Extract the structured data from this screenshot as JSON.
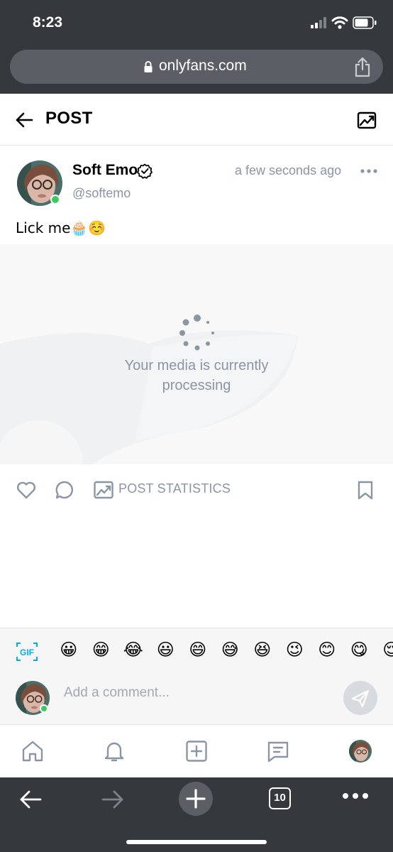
{
  "status_bar": {
    "time": "8:23"
  },
  "browser": {
    "url": "onlyfans.com",
    "tab_count": "10"
  },
  "header": {
    "title": "POST"
  },
  "post": {
    "author_name": "Soft Emo",
    "author_handle": "@softemo",
    "timestamp": "a few seconds ago",
    "text": "Lick me🧁☺️",
    "media_status": "Your media is currently processing"
  },
  "actions": {
    "post_statistics_label": "POST STATISTICS"
  },
  "comment": {
    "placeholder": "Add a comment...",
    "gif_label": "GIF",
    "emojis": [
      "😀",
      "😁",
      "😂",
      "😃",
      "😄",
      "😅",
      "😆",
      "😉",
      "😊",
      "😋",
      "😌"
    ]
  },
  "colors": {
    "accent": "#00aff0",
    "muted": "#8a96a3",
    "online": "#3ec960",
    "chrome": "#35383d"
  },
  "icons": {
    "header": [
      "back-arrow-icon",
      "image-stats-icon"
    ],
    "actions": [
      "heart-icon",
      "comment-bubble-icon",
      "stats-icon",
      "bookmark-icon"
    ],
    "nav": [
      "home-icon",
      "bell-icon",
      "plus-square-icon",
      "message-icon",
      "avatar"
    ],
    "browser": [
      "back-icon",
      "forward-icon",
      "new-tab-icon",
      "tabs-icon",
      "more-icon"
    ]
  }
}
